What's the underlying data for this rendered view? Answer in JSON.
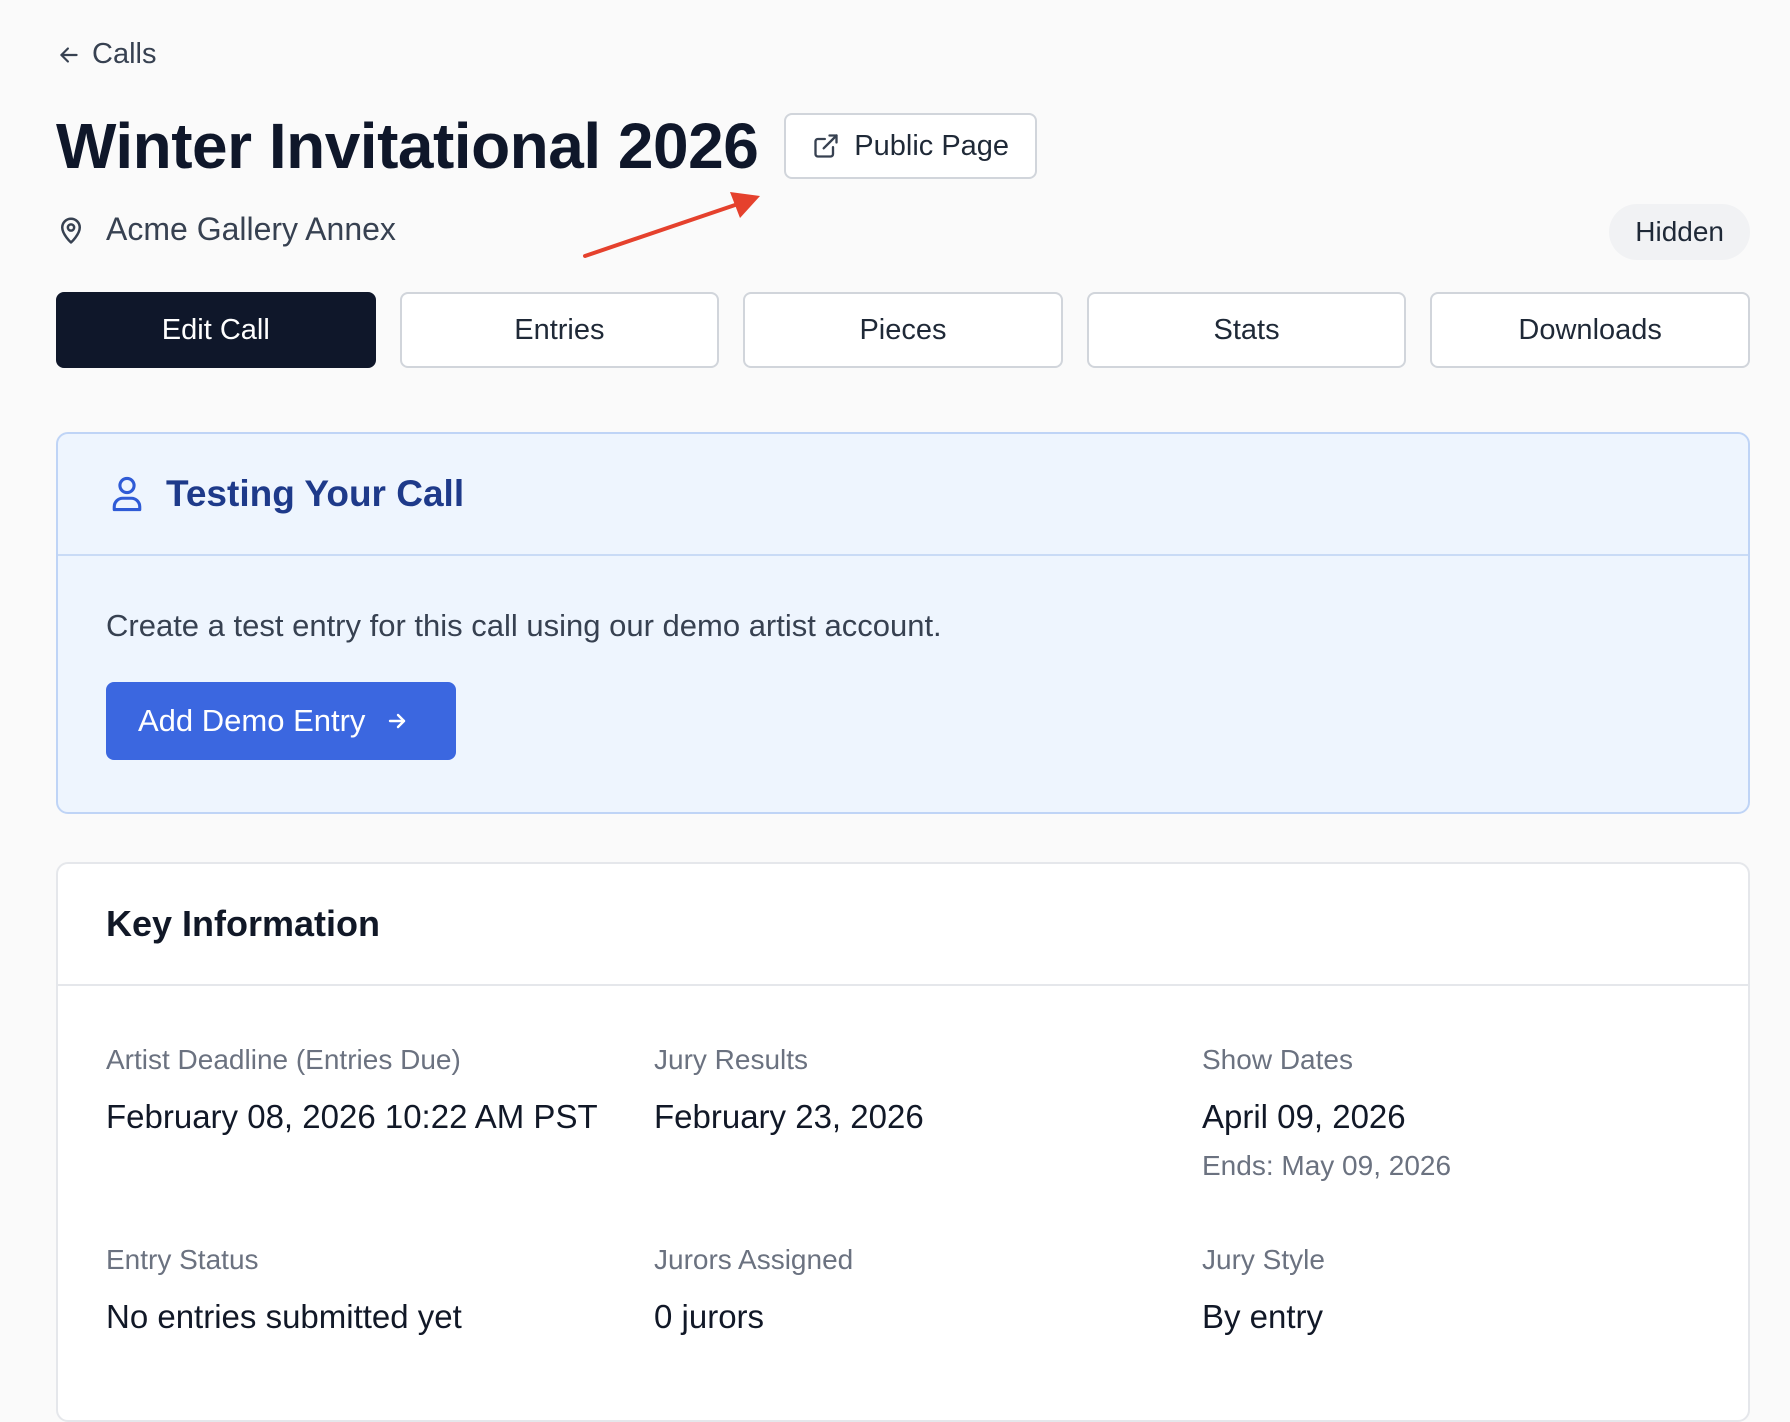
{
  "back_link": {
    "label": "Calls"
  },
  "header": {
    "title": "Winter Invitational 2026",
    "public_page_label": "Public Page",
    "location": "Acme Gallery Annex",
    "visibility_badge": "Hidden"
  },
  "tabs": [
    {
      "label": "Edit Call",
      "active": true
    },
    {
      "label": "Entries",
      "active": false
    },
    {
      "label": "Pieces",
      "active": false
    },
    {
      "label": "Stats",
      "active": false
    },
    {
      "label": "Downloads",
      "active": false
    }
  ],
  "testing": {
    "title": "Testing Your Call",
    "description": "Create a test entry for this call using our demo artist account.",
    "button_label": "Add Demo Entry"
  },
  "key_info": {
    "title": "Key Information",
    "items": [
      {
        "label": "Artist Deadline (Entries Due)",
        "value": "February 08, 2026 10:22 AM PST",
        "sub": ""
      },
      {
        "label": "Jury Results",
        "value": "February 23, 2026",
        "sub": ""
      },
      {
        "label": "Show Dates",
        "value": "April 09, 2026",
        "sub": "Ends: May 09, 2026"
      },
      {
        "label": "Entry Status",
        "value": "No entries submitted yet",
        "sub": ""
      },
      {
        "label": "Jurors Assigned",
        "value": "0 jurors",
        "sub": ""
      },
      {
        "label": "Jury Style",
        "value": "By entry",
        "sub": ""
      }
    ]
  },
  "colors": {
    "primary_dark": "#0f172a",
    "accent_blue": "#3b67e0",
    "annotation_arrow": "#e5412d"
  }
}
